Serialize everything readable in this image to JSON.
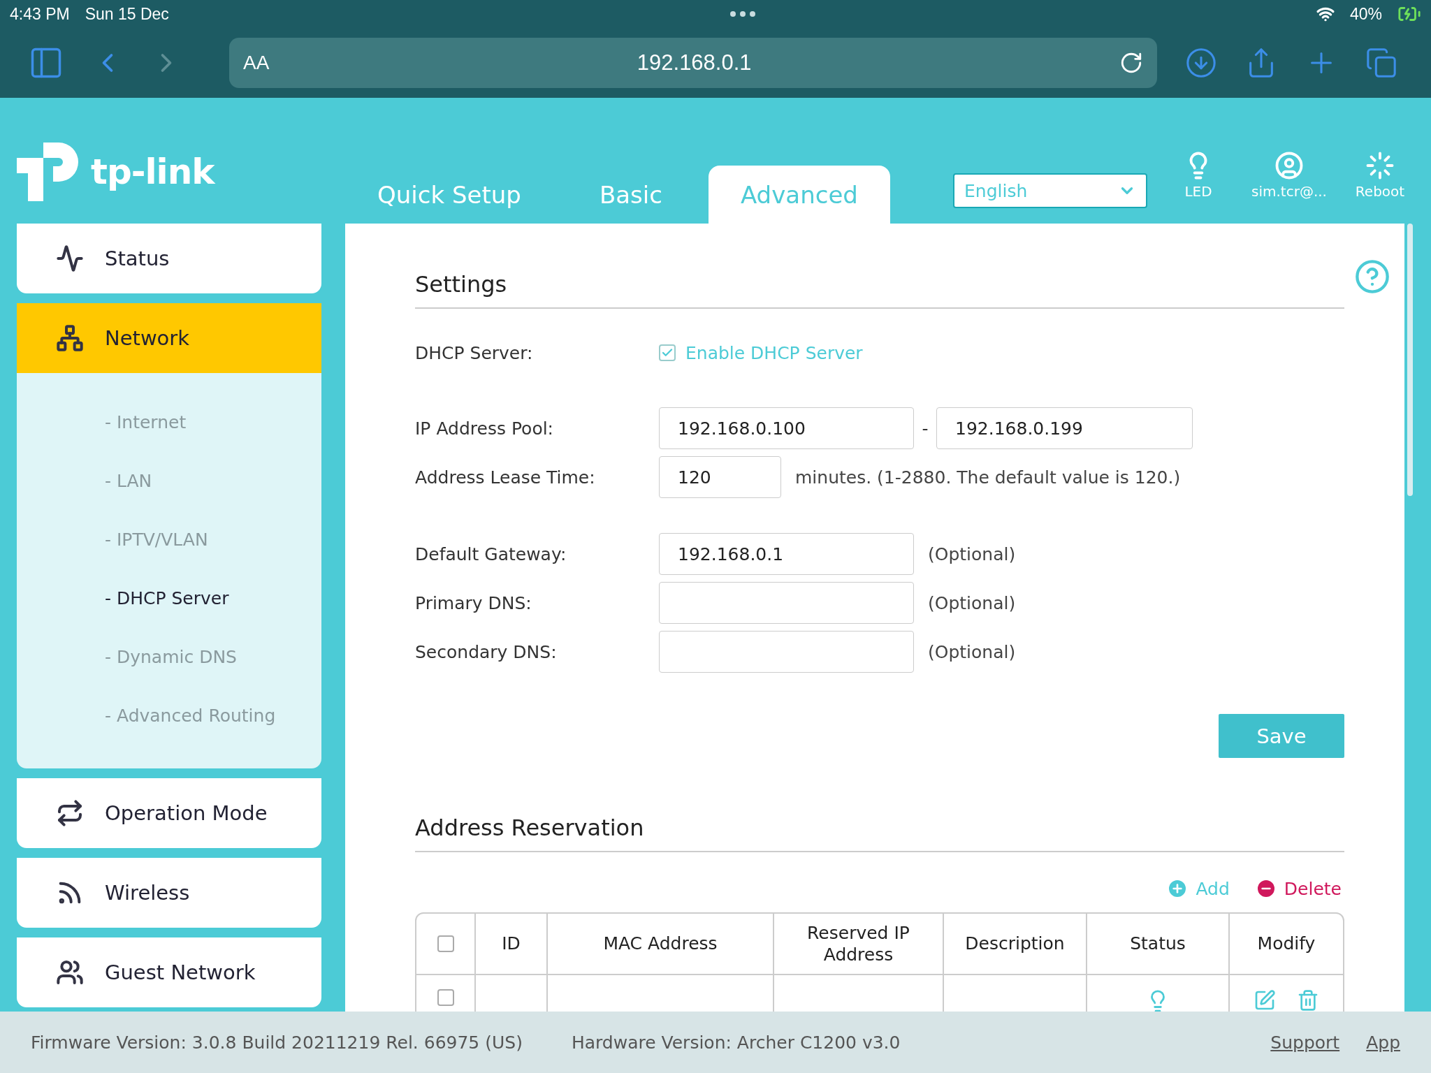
{
  "status_bar": {
    "time": "4:43 PM",
    "date": "Sun 15 Dec",
    "battery": "40%"
  },
  "browser": {
    "reader_label": "AA",
    "url": "192.168.0.1",
    "forward_disabled": true
  },
  "header": {
    "logo": "tp-link",
    "tabs": [
      {
        "label": "Quick Setup",
        "selected": false
      },
      {
        "label": "Basic",
        "selected": false
      },
      {
        "label": "Advanced",
        "selected": true
      }
    ],
    "language": "English",
    "actions": [
      {
        "kind": "led",
        "label": "LED"
      },
      {
        "kind": "account",
        "label": "sim.tcr@..."
      },
      {
        "kind": "reboot",
        "label": "Reboot"
      }
    ]
  },
  "sidebar": {
    "items": [
      {
        "kind": "status",
        "label": "Status",
        "selected": false,
        "expanded": false
      },
      {
        "kind": "network",
        "label": "Network",
        "selected": true,
        "expanded": true,
        "children": [
          {
            "marker": "-",
            "label": "Internet",
            "selected": false
          },
          {
            "marker": "-",
            "label": "LAN",
            "selected": false
          },
          {
            "marker": "-",
            "label": "IPTV/VLAN",
            "selected": false
          },
          {
            "marker": "-",
            "label": "DHCP Server",
            "selected": true
          },
          {
            "marker": "-",
            "label": "Dynamic DNS",
            "selected": false
          },
          {
            "marker": "-",
            "label": "Advanced Routing",
            "selected": false
          }
        ]
      },
      {
        "kind": "mode",
        "label": "Operation Mode",
        "selected": false,
        "expanded": false
      },
      {
        "kind": "wireless",
        "label": "Wireless",
        "selected": false,
        "expanded": false
      },
      {
        "kind": "guest",
        "label": "Guest Network",
        "selected": false,
        "expanded": false
      }
    ]
  },
  "settings": {
    "title": "Settings",
    "dhcp": {
      "label": "DHCP Server:",
      "checkbox_label": "Enable DHCP Server",
      "checked": true
    },
    "fields": [
      {
        "kind": "range",
        "label": "IP Address Pool:",
        "values": [
          "192.168.0.100",
          "192.168.0.199"
        ],
        "separator": "-"
      },
      {
        "kind": "short",
        "label": "Address Lease Time:",
        "value": "120",
        "note": "minutes. (1-2880. The default value is 120.)"
      },
      {
        "kind": "text",
        "label": "Default Gateway:",
        "value": "192.168.0.1",
        "note": "(Optional)"
      },
      {
        "kind": "text",
        "label": "Primary DNS:",
        "note": "(Optional)"
      },
      {
        "kind": "text",
        "label": "Secondary DNS:",
        "note": "(Optional)"
      }
    ],
    "save": "Save"
  },
  "reservation": {
    "title": "Address Reservation",
    "add": "Add",
    "delete": "Delete",
    "select_all_checked": false,
    "columns": [
      "ID",
      "MAC Address",
      "Reserved IP Address",
      "Description",
      "Status",
      "Modify"
    ],
    "rows": [
      {
        "checked": false
      }
    ]
  },
  "footer": {
    "firmware": "Firmware Version: 3.0.8 Build 20211219 Rel. 66975 (US)",
    "hardware": "Hardware Version: Archer C1200 v3.0",
    "links": [
      "Support",
      "App"
    ]
  }
}
